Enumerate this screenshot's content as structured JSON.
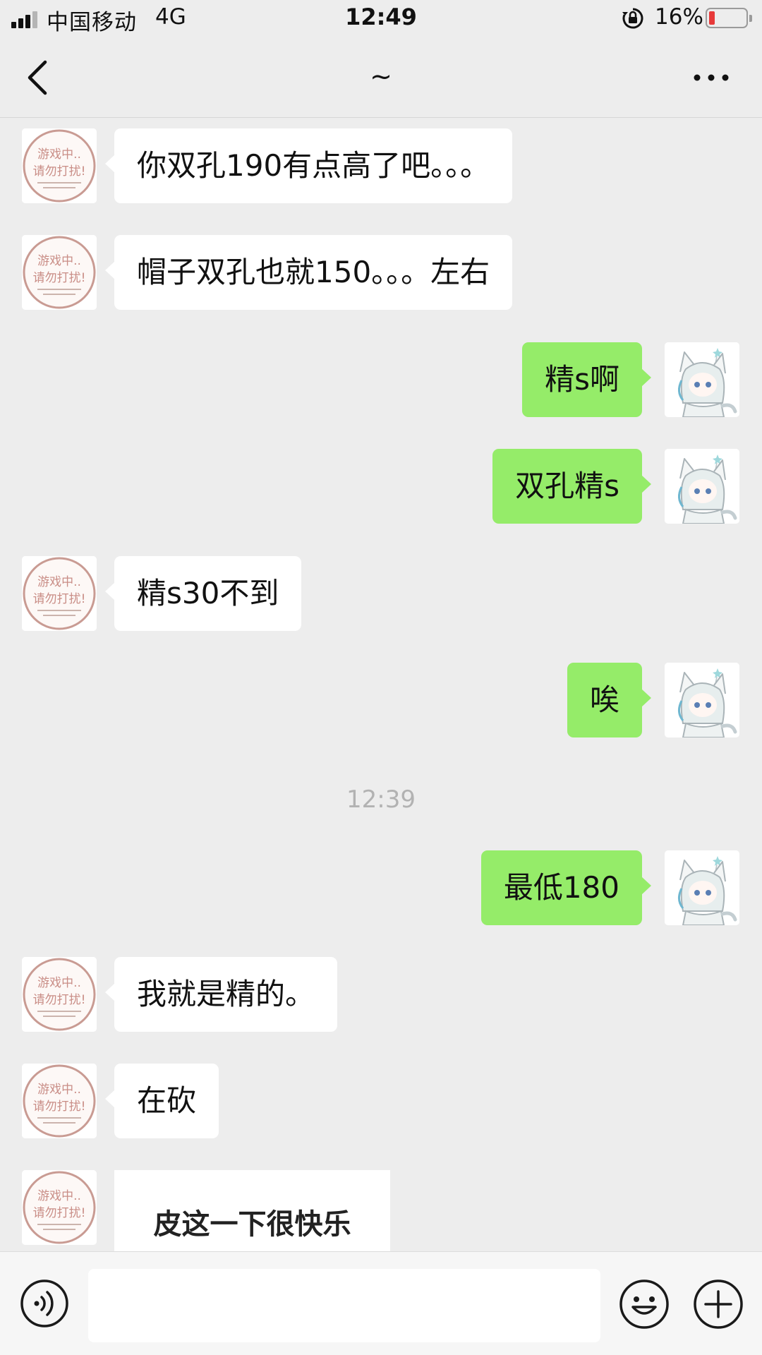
{
  "status_bar": {
    "carrier": "中国移动",
    "network": "4G",
    "time": "12:49",
    "battery_percent": "16%",
    "battery_level": 0.16,
    "battery_color": "#e73a3a"
  },
  "nav": {
    "title": "~",
    "back_icon": "chevron-left-icon",
    "more_icon": "more-dots-icon"
  },
  "contact_avatar_text": {
    "line1": "游戏中..",
    "line2": "请勿打扰!"
  },
  "messages": [
    {
      "side": "left",
      "text": "你双孔190有点高了吧。。。"
    },
    {
      "side": "left",
      "text": "帽子双孔也就150。。。左右"
    },
    {
      "side": "right",
      "text": "精s啊"
    },
    {
      "side": "right",
      "text": "双孔精s"
    },
    {
      "side": "left",
      "text": "精s30不到"
    },
    {
      "side": "right",
      "text": "唉"
    },
    {
      "timestamp": "12:39"
    },
    {
      "side": "right",
      "text": "最低180"
    },
    {
      "side": "left",
      "text": "我就是精的。"
    },
    {
      "side": "left",
      "text": "在砍"
    },
    {
      "side": "left",
      "sticker_text": "皮这一下很快乐"
    }
  ],
  "input_bar": {
    "voice_icon": "voice-icon",
    "text_value": "",
    "emoji_icon": "emoji-icon",
    "plus_icon": "plus-icon"
  },
  "colors": {
    "sent_bubble": "#95ec69",
    "received_bubble": "#ffffff",
    "background": "#ededed"
  }
}
